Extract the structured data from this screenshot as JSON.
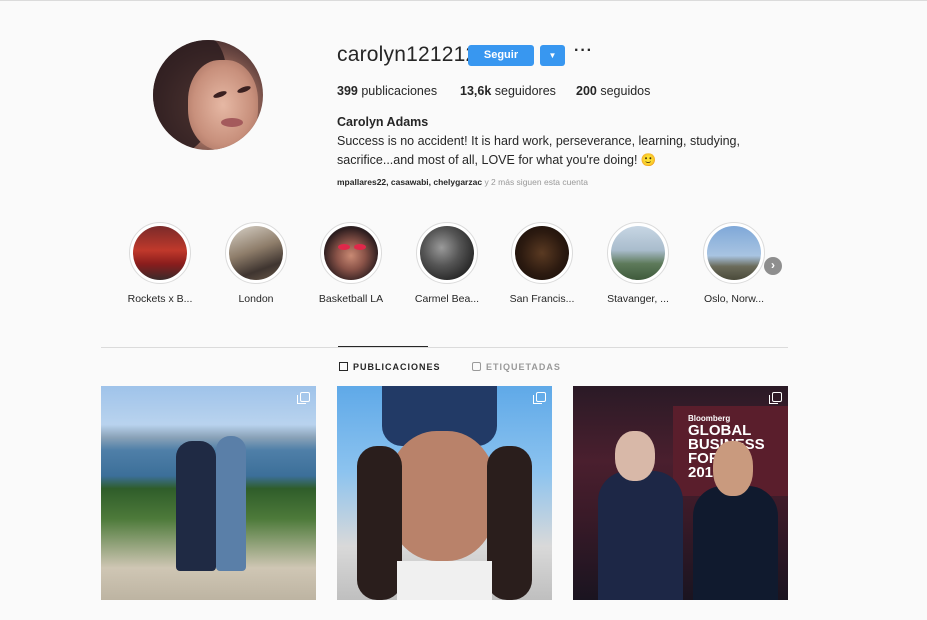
{
  "profile": {
    "username": "carolyn121212",
    "follow_label": "Seguir",
    "dropdown_icon": "caret-down-icon",
    "more_icon": "more-options-icon",
    "stats": {
      "posts_count": "399",
      "posts_label": "publicaciones",
      "followers_count": "13,6k",
      "followers_label": "seguidores",
      "following_count": "200",
      "following_label": "seguidos"
    },
    "full_name": "Carolyn Adams",
    "bio": "Success is no accident! It is hard work, perseverance, learning, studying, sacrifice...and most of all, LOVE for what you're doing! 🙂",
    "followed_by_names": "mpallares22, casawabi, chelygarzac",
    "followed_by_more": "y 2 más siguen esta cuenta"
  },
  "highlights": [
    {
      "label": "Rockets x B..."
    },
    {
      "label": "London"
    },
    {
      "label": "Basketball LA"
    },
    {
      "label": "Carmel Bea..."
    },
    {
      "label": "San Francis..."
    },
    {
      "label": "Stavanger, ..."
    },
    {
      "label": "Oslo, Norw..."
    }
  ],
  "tabs": {
    "posts": "PUBLICACIONES",
    "tagged": "ETIQUETADAS"
  },
  "colors": {
    "accent": "#3897f0",
    "background": "#fafafa",
    "text": "#262626",
    "muted": "#999999"
  }
}
